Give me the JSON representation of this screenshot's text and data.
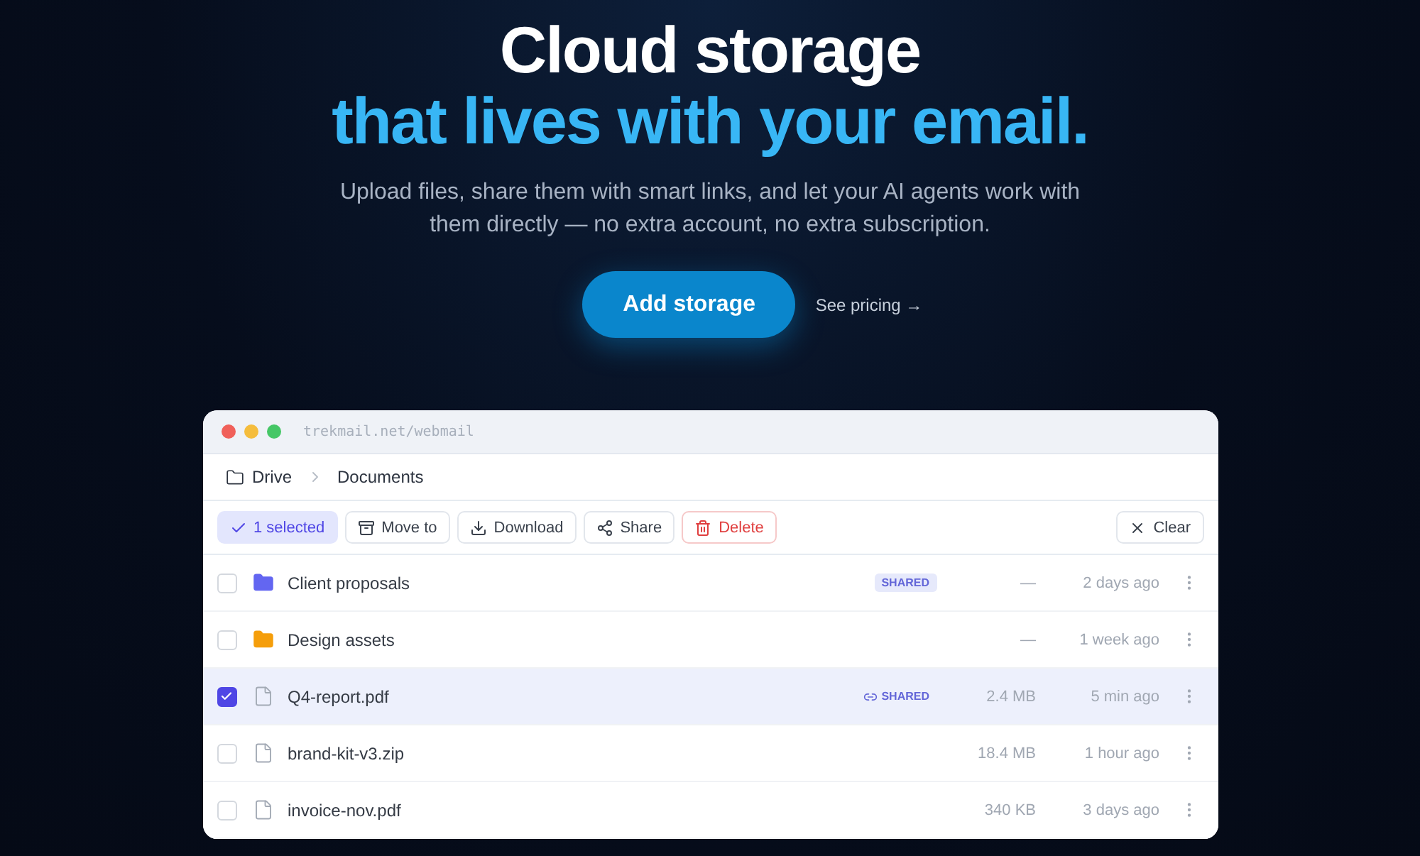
{
  "hero": {
    "title_line_1": "Cloud storage",
    "title_line_2": "that lives with your email.",
    "subtitle": "Upload files, share them with smart links, and let your AI agents work with them directly — no extra account, no extra subscription.",
    "primary_button": "Add storage",
    "secondary_link": "See pricing →"
  },
  "window": {
    "url": "trekmail.net/webmail"
  },
  "breadcrumb": [
    "Drive",
    "Documents"
  ],
  "toolbar": {
    "selection": "1 selected",
    "actions": [
      {
        "label": "Move to",
        "kind": "move"
      },
      {
        "label": "Download",
        "kind": "download"
      },
      {
        "label": "Share",
        "kind": "share"
      },
      {
        "label": "Delete",
        "kind": "delete"
      }
    ],
    "clear": "Clear"
  },
  "files": [
    {
      "name": "Client proposals",
      "kind": "folder",
      "color": "#6366f1",
      "selected": false,
      "shared": {
        "label": "SHARED",
        "kind": "badge"
      },
      "size": "—",
      "modified": "2 days ago"
    },
    {
      "name": "Design assets",
      "kind": "folder",
      "color": "#f59e0b",
      "selected": false,
      "size": "—",
      "modified": "1 week ago"
    },
    {
      "name": "Q4-report.pdf",
      "kind": "file",
      "selected": true,
      "shared": {
        "label": "SHARED",
        "kind": "link"
      },
      "size": "2.4 MB",
      "modified": "5 min ago"
    },
    {
      "name": "brand-kit-v3.zip",
      "kind": "file",
      "selected": false,
      "size": "18.4 MB",
      "modified": "1 hour ago"
    },
    {
      "name": "invoice-nov.pdf",
      "kind": "file",
      "selected": false,
      "size": "340 KB",
      "modified": "3 days ago"
    }
  ]
}
